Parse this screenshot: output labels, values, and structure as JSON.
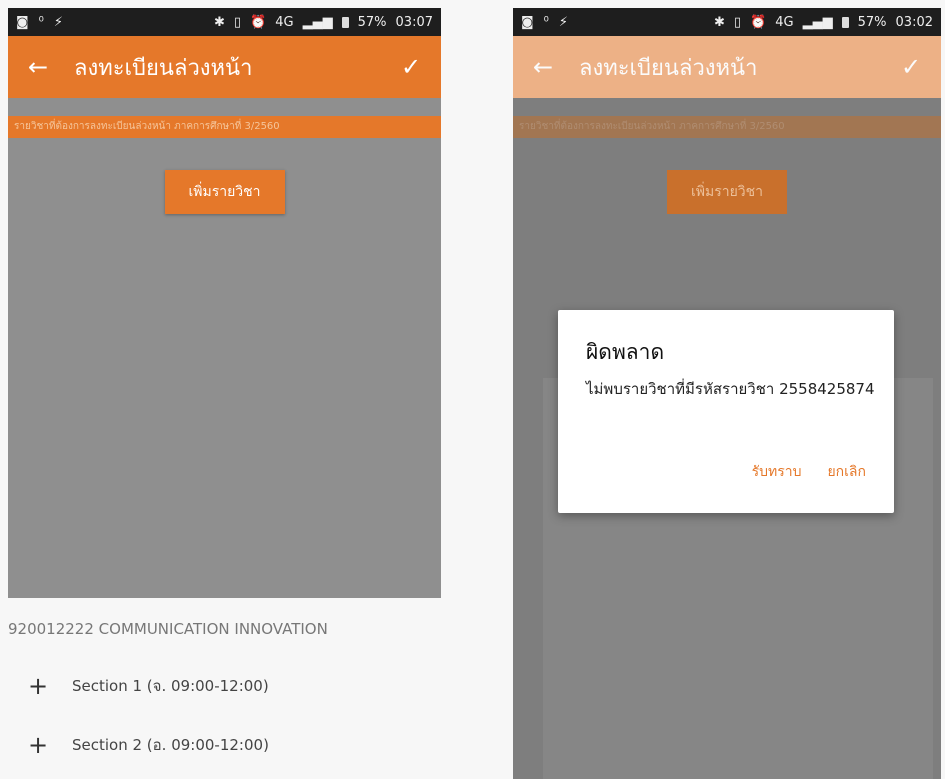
{
  "left_screen": {
    "status": {
      "network": "4G",
      "battery": "57%",
      "time": "03:07"
    },
    "toolbar": {
      "title": "ลงทะเบียนล่วงหน้า"
    },
    "banner": "รายวิชาที่ต้องการลงทะเบียนล่วงหน้า ภาคการศึกษาที่ 3/2560",
    "add_button": "เพิ่มรายวิชา",
    "course": "920012222 COMMUNICATION INNOVATION",
    "sections": [
      {
        "label": "Section 1 (จ. 09:00-12:00)"
      },
      {
        "label": "Section 2 (อ. 09:00-12:00)"
      }
    ]
  },
  "right_screen": {
    "status": {
      "network": "4G",
      "battery": "57%",
      "time": "03:02"
    },
    "toolbar": {
      "title": "ลงทะเบียนล่วงหน้า"
    },
    "banner": "รายวิชาที่ต้องการลงทะเบียนล่วงหน้า ภาคการศึกษาที่ 3/2560",
    "add_button": "เพิ่มรายวิชา",
    "dialog": {
      "title": "ผิดพลาด",
      "message": "ไม่พบรายวิชาที่มีรหัสรายวิชา 2558425874",
      "ok_label": "รับทราบ",
      "cancel_label": "ยกเลิก"
    }
  },
  "icons": {
    "back": "back-arrow-icon",
    "confirm": "check-icon",
    "add": "plus-icon"
  },
  "colors": {
    "accent": "#e5782a",
    "status_bar": "#1e1e1e"
  }
}
